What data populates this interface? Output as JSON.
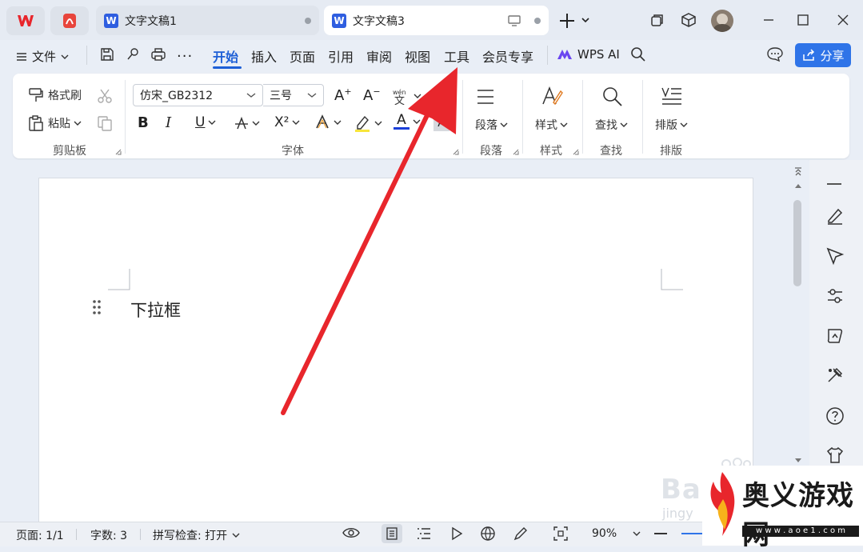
{
  "tabs": [
    {
      "label": "文字文稿1"
    },
    {
      "label": "文字文稿3"
    }
  ],
  "menu": {
    "file": "文件",
    "items": [
      "开始",
      "插入",
      "页面",
      "引用",
      "审阅",
      "视图",
      "工具",
      "会员专享"
    ],
    "wps_ai": "WPS AI",
    "share": "分享"
  },
  "ribbon": {
    "format_painter": "格式刷",
    "paste": "粘贴",
    "clipboard_group": "剪贴板",
    "font_name": "仿宋_GB2312",
    "font_size": "三号",
    "font_group": "字体",
    "paragraph": "段落",
    "paragraph_group": "段落",
    "styles": "样式",
    "styles_group": "样式",
    "find": "查找",
    "find_group": "查找",
    "layout": "排版",
    "layout_group": "排版",
    "bold": "B",
    "italic": "I",
    "underline": "U",
    "superscript": "X²",
    "grow_font": "A",
    "shrink_font": "A",
    "font_color_letter": "A",
    "highlight_letter": "A"
  },
  "document": {
    "text": "下拉框"
  },
  "status": {
    "page": "页面: 1/1",
    "word_count": "字数: 3",
    "spell_check": "拼写检查: 打开",
    "zoom": "90%"
  },
  "watermark": {
    "brand": "奥义游戏网",
    "url": "w w w . a o e 1 . c o m",
    "baidu": "Ba",
    "baidu_sub": "jingy"
  },
  "colors": {
    "accent": "#1d5fd6",
    "share_bg": "#2f74e8",
    "font_color_bar": "#1a3fd9",
    "arrow": "#e8262c"
  }
}
